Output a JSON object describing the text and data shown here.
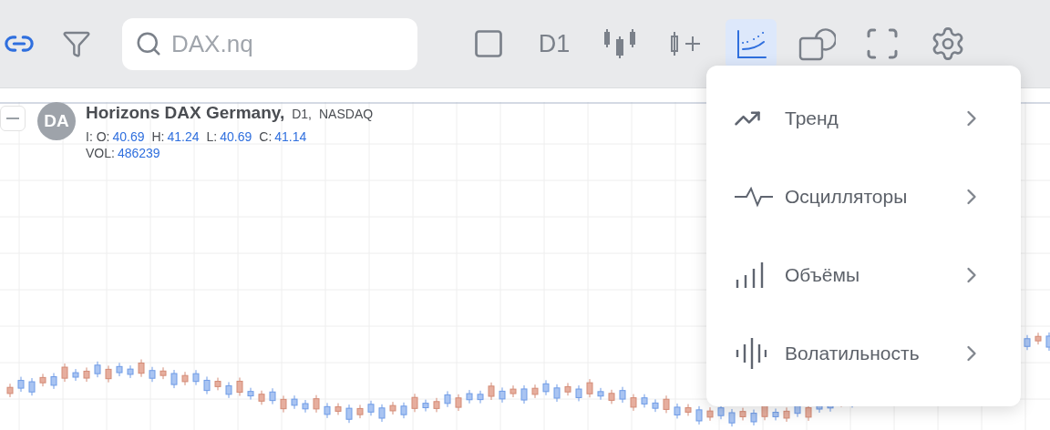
{
  "toolbar": {
    "tools": [
      {
        "kind": "link",
        "selected": false
      },
      {
        "kind": "filter",
        "selected": false
      },
      {
        "kind": "search",
        "placeholder": "DAX.nq"
      },
      {
        "kind": "layout",
        "selected": false
      },
      {
        "kind": "timeframe",
        "label": "D1",
        "selected": false
      },
      {
        "kind": "chart-type",
        "selected": false
      },
      {
        "kind": "compare",
        "selected": false
      },
      {
        "kind": "indicators",
        "selected": true
      },
      {
        "kind": "drawings",
        "selected": false
      },
      {
        "kind": "fullscreen",
        "selected": false
      },
      {
        "kind": "settings",
        "selected": false
      }
    ]
  },
  "legend": {
    "avatar": "DA",
    "title": "Horizons DAX Germany,",
    "timeframe": "D1,",
    "exchange": "NASDAQ",
    "values": [
      {
        "label": "I: O:",
        "value": "40.69"
      },
      {
        "label": "H:",
        "value": "41.24"
      },
      {
        "label": "L:",
        "value": "40.69"
      },
      {
        "label": "C:",
        "value": "41.14"
      }
    ],
    "volume": {
      "label": "VOL:",
      "value": "486239"
    }
  },
  "indicator_menu": {
    "items": [
      {
        "kind": "trend",
        "label": "Тренд"
      },
      {
        "kind": "oscillators",
        "label": "Осцилляторы"
      },
      {
        "kind": "volumes",
        "label": "Объёмы"
      },
      {
        "kind": "volatility",
        "label": "Волатильность"
      }
    ]
  }
}
